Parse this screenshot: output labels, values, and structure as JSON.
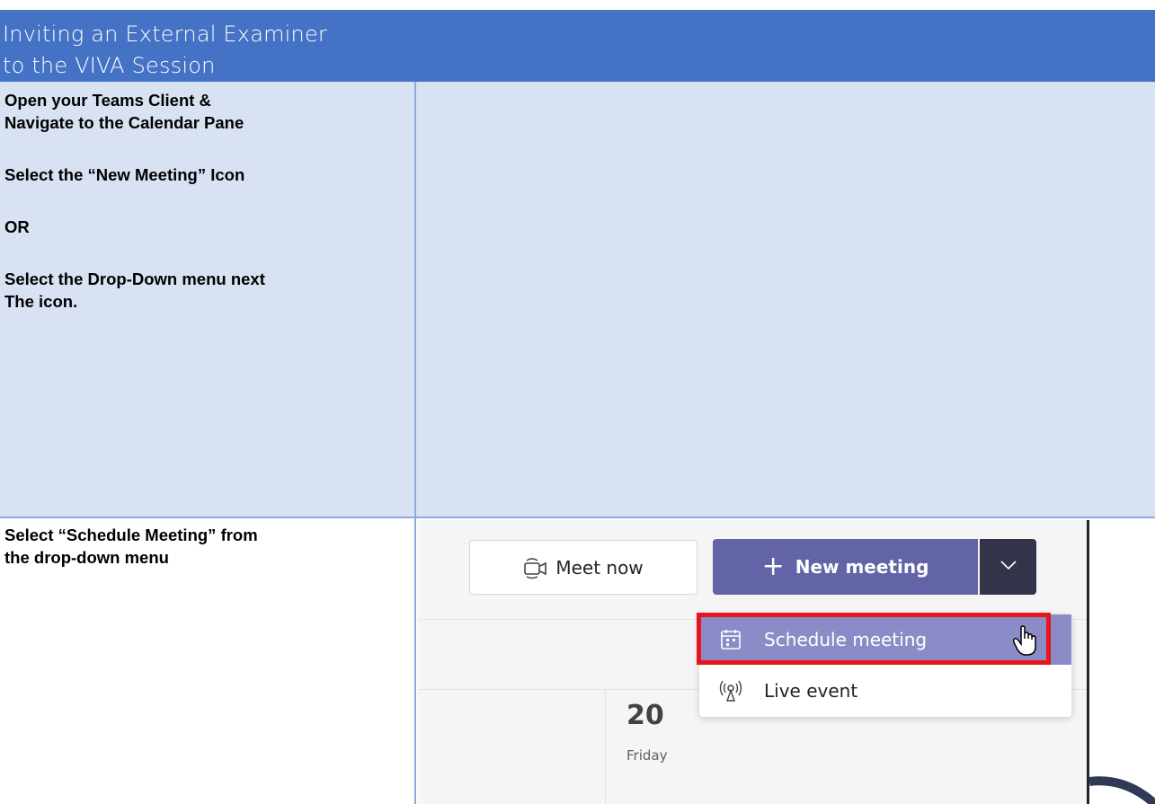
{
  "header": {
    "title_line1": "Inviting an External Examiner",
    "title_line2": "to the VIVA Session"
  },
  "step1": {
    "line1": "Open your Teams Client &",
    "line2": "Navigate to the Calendar Pane",
    "line3": "Select the “New Meeting” Icon",
    "line4": "OR",
    "line5": "Select the Drop-Down menu next",
    "line6": "The icon."
  },
  "step2": {
    "line1": "Select “Schedule Meeting” from",
    "line2": "the drop-down menu"
  },
  "teams": {
    "meet_now_label": "Meet now",
    "new_meeting_label": "New meeting",
    "plus_symbol": "+",
    "menu": {
      "schedule_label": "Schedule meeting",
      "live_event_label": "Live event"
    },
    "calendar": {
      "date_number": "20",
      "day_name": "Friday"
    }
  },
  "colors": {
    "header_bg": "#4472c4",
    "table_shade": "#d9e2f3",
    "teams_purple": "#6264a7",
    "menu_highlight": "#8b8cc7",
    "annotation_red": "#e8141b"
  },
  "icons": [
    "video-camera-icon",
    "chevron-down-icon",
    "calendar-icon",
    "broadcast-icon",
    "hand-cursor-icon"
  ]
}
